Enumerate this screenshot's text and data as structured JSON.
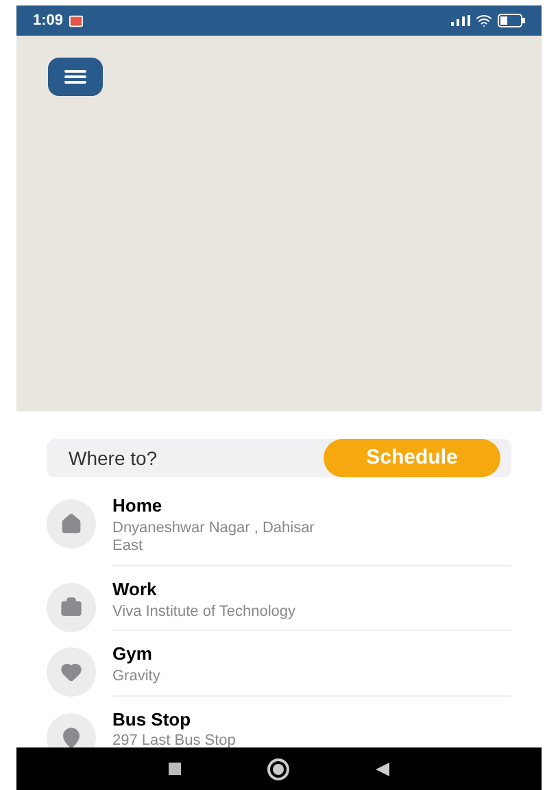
{
  "status_bar": {
    "time": "1:09"
  },
  "search": {
    "placeholder": "Where to?"
  },
  "schedule_button": "Schedule",
  "places": [
    {
      "kind": "home",
      "title": "Home",
      "address": "Dnyaneshwar Nagar , Dahisar East"
    },
    {
      "kind": "work",
      "title": "Work",
      "address": "Viva Institute of Technology"
    },
    {
      "kind": "gym",
      "title": "Gym",
      "address": "Gravity"
    },
    {
      "kind": "stop",
      "title": "Bus Stop",
      "address": "297 Last Bus Stop"
    }
  ]
}
